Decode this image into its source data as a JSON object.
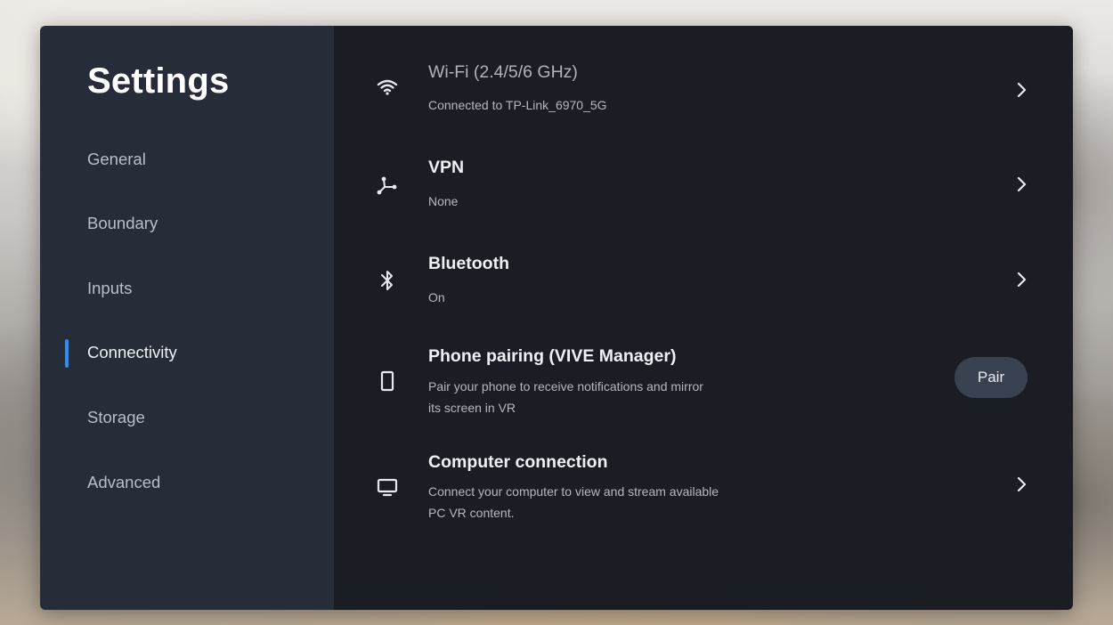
{
  "sidebar": {
    "title": "Settings",
    "items": [
      {
        "label": "General"
      },
      {
        "label": "Boundary"
      },
      {
        "label": "Inputs"
      },
      {
        "label": "Connectivity",
        "active": true
      },
      {
        "label": "Storage"
      },
      {
        "label": "Advanced"
      }
    ]
  },
  "connectivity": {
    "wifi": {
      "title": "Wi-Fi (2.4/5/6 GHz)",
      "subtitle": "Connected to TP-Link_6970_5G",
      "icon": "wifi-icon"
    },
    "vpn": {
      "title": "VPN",
      "subtitle": "None",
      "icon": "vpn-icon"
    },
    "bluetooth": {
      "title": "Bluetooth",
      "subtitle": "On",
      "icon": "bluetooth-icon"
    },
    "phone": {
      "title": "Phone pairing (VIVE Manager)",
      "subtitle_line1": "Pair your phone to receive notifications and mirror",
      "subtitle_line2": "its screen in VR",
      "button_label": "Pair",
      "icon": "phone-icon"
    },
    "computer": {
      "title": "Computer connection",
      "subtitle_line1": "Connect your computer to view and stream available",
      "subtitle_line2": "PC VR content.",
      "icon": "monitor-icon"
    }
  },
  "colors": {
    "sidebar_bg": "#262c38",
    "content_bg": "#1a1d24",
    "accent": "#2f8cf0",
    "pair_button_bg": "#3a4150"
  }
}
